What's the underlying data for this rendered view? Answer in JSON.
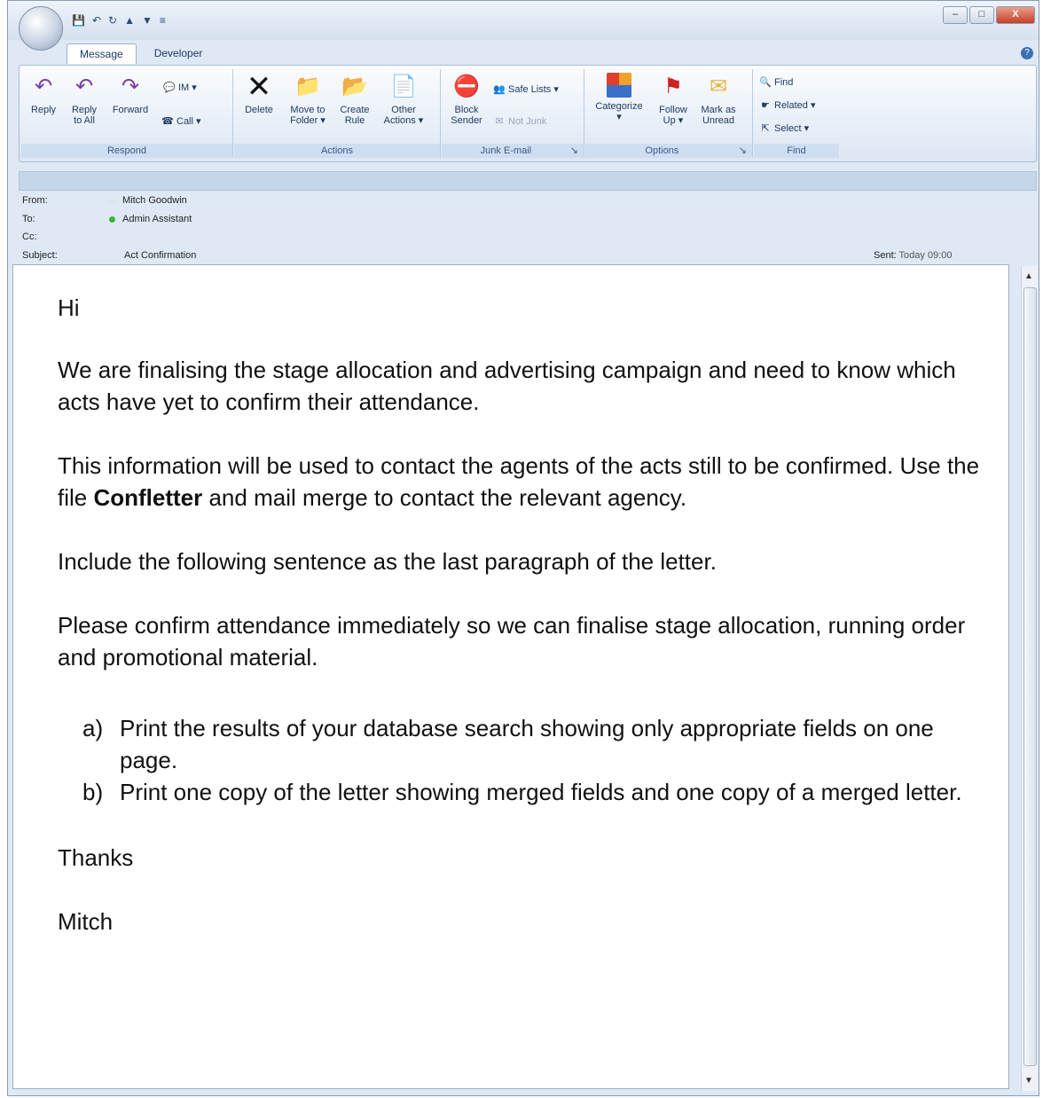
{
  "qat": {
    "icons": [
      "save-icon",
      "undo-icon",
      "redo-icon",
      "up-arrow-icon",
      "down-arrow-icon"
    ]
  },
  "tabs": [
    {
      "label": "Message"
    },
    {
      "label": "Developer"
    }
  ],
  "ribbon": {
    "respond": {
      "label": "Respond",
      "reply": "Reply",
      "reply_all_1": "Reply",
      "reply_all_2": "to All",
      "forward": "Forward",
      "im": "IM",
      "call": "Call"
    },
    "actions": {
      "label": "Actions",
      "delete": "Delete",
      "move_1": "Move to",
      "move_2": "Folder",
      "rule_1": "Create",
      "rule_2": "Rule",
      "other_1": "Other",
      "other_2": "Actions"
    },
    "junk": {
      "label": "Junk E-mail",
      "block_1": "Block",
      "block_2": "Sender",
      "safe_lists": "Safe Lists",
      "not_junk": "Not Junk"
    },
    "options": {
      "label": "Options",
      "categorize": "Categorize",
      "follow_1": "Follow",
      "follow_2": "Up",
      "mark_1": "Mark as",
      "mark_2": "Unread"
    },
    "find": {
      "label": "Find",
      "find": "Find",
      "related": "Related",
      "select": "Select"
    }
  },
  "header": {
    "from_label": "From:",
    "from": "Mitch Goodwin",
    "to_label": "To:",
    "to": "Admin Assistant",
    "cc_label": "Cc:",
    "subject_label": "Subject:",
    "subject": "Act Confirmation",
    "sent_label": "Sent:",
    "sent": "Today 09:00"
  },
  "message": {
    "greeting": "Hi",
    "p1": "We are finalising the stage allocation and advertising campaign and need to know which acts have yet to confirm their attendance.",
    "p2_a": "This information will be used to contact the agents of the acts still to be confirmed.  Use the file ",
    "p2_bold": "Confletter",
    "p2_b": " and mail merge to contact the relevant agency.",
    "p3": "Include the following sentence as the last paragraph of the letter.",
    "p4": "Please confirm attendance immediately so we can finalise stage allocation, running order and promotional material.",
    "items": [
      {
        "label": "a)",
        "text": "Print the results of your database search showing only appropriate fields on one page."
      },
      {
        "label": "b)",
        "text": "Print one copy of the letter showing merged fields and one copy of a merged letter."
      }
    ],
    "thanks": "Thanks",
    "signature": "Mitch"
  }
}
